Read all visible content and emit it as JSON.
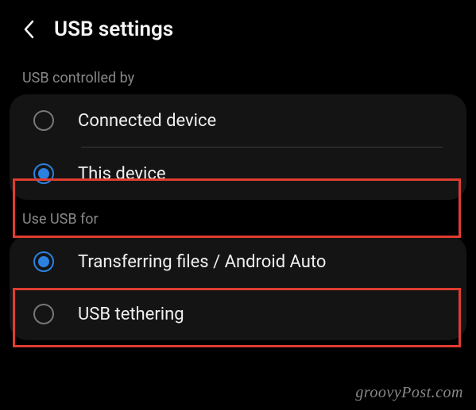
{
  "header": {
    "title": "USB settings"
  },
  "section1": {
    "label": "USB controlled by",
    "options": [
      {
        "label": "Connected device"
      },
      {
        "label": "This device"
      }
    ]
  },
  "section2": {
    "label": "Use USB for",
    "options": [
      {
        "label": "Transferring files / Android Auto"
      },
      {
        "label": "USB tethering"
      }
    ]
  },
  "watermark": "groovyPost.com"
}
